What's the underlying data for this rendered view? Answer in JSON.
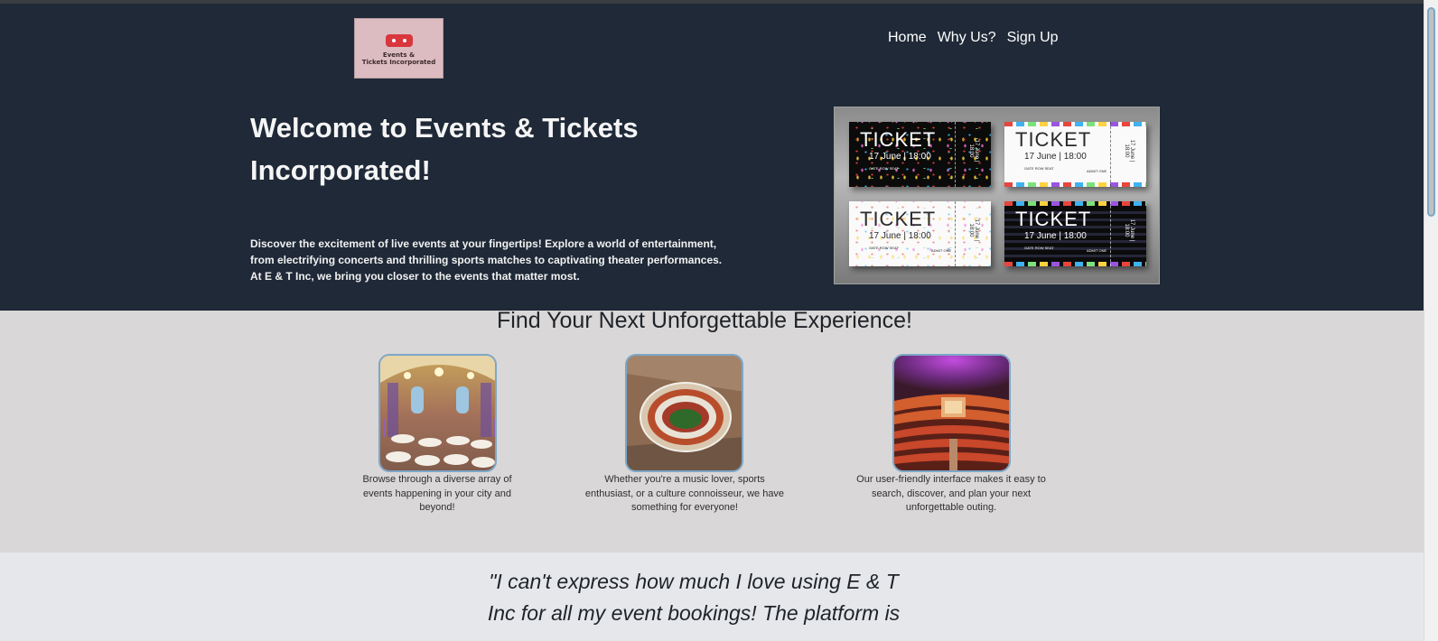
{
  "logo": {
    "text_line1": "Events &",
    "text_line2": "Tickets Incorporated"
  },
  "nav": {
    "items": [
      {
        "label": "Home"
      },
      {
        "label": "Why Us?"
      },
      {
        "label": "Sign Up"
      }
    ]
  },
  "hero": {
    "title": "Welcome to Events & Tickets Incorporated!",
    "intro": "Discover the excitement of live events at your fingertips! Explore a world of entertainment, from electrifying concerts and thrilling sports matches to captivating theater performances. At E & T Inc, we bring you closer to the events that matter most."
  },
  "tickets_image": {
    "ticket_word": "TICKET",
    "date_text": "17 June | 18:00",
    "admit_text": "ADMIT ONE",
    "small_text": "GATE  ROW  SEAT",
    "stub_text": "17 June | 18:00"
  },
  "features": {
    "heading": "Find Your Next Unforgettable Experience!",
    "cards": [
      {
        "text": "Browse through a diverse array of events happening in your city and beyond!"
      },
      {
        "text": "Whether you're a music lover, sports enthusiast, or a culture connoisseur, we have something for everyone!"
      },
      {
        "text": "Our user-friendly interface makes it easy to search, discover, and plan your next unforgettable outing."
      }
    ]
  },
  "testimonial": {
    "quote": "\"I can't express how much I love using E & T Inc for all my event bookings! The platform is"
  },
  "colors": {
    "header_bg": "#1f2937",
    "features_bg": "#d9d7d7",
    "testimonial_bg": "#e5e7eb",
    "thumb_border": "#7ca7c9"
  }
}
